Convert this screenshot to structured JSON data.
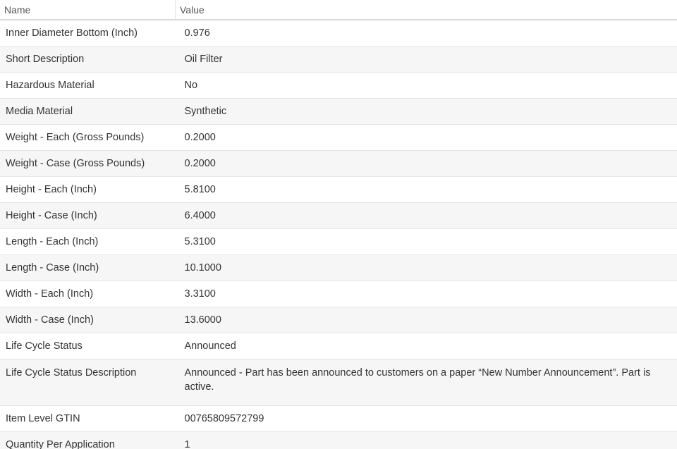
{
  "header": {
    "name_label": "Name",
    "value_label": "Value"
  },
  "rows": [
    {
      "name": "Inner Diameter Bottom (Inch)",
      "value": "0.976"
    },
    {
      "name": "Short Description",
      "value": "Oil Filter"
    },
    {
      "name": "Hazardous Material",
      "value": "No"
    },
    {
      "name": "Media Material",
      "value": "Synthetic"
    },
    {
      "name": "Weight - Each (Gross Pounds)",
      "value": "0.2000"
    },
    {
      "name": "Weight - Case (Gross Pounds)",
      "value": "0.2000"
    },
    {
      "name": "Height - Each (Inch)",
      "value": "5.8100"
    },
    {
      "name": "Height - Case (Inch)",
      "value": "6.4000"
    },
    {
      "name": "Length - Each (Inch)",
      "value": "5.3100"
    },
    {
      "name": "Length - Case (Inch)",
      "value": "10.1000"
    },
    {
      "name": "Width - Each (Inch)",
      "value": "3.3100"
    },
    {
      "name": "Width - Case (Inch)",
      "value": "13.6000"
    },
    {
      "name": "Life Cycle Status",
      "value": "Announced"
    },
    {
      "name": "Life Cycle Status Description",
      "value": "Announced - Part has been announced to customers on a paper “New Number Announcement”. Part is active."
    },
    {
      "name": "Item Level GTIN",
      "value": "00765809572799"
    },
    {
      "name": "Quantity Per Application",
      "value": "1"
    }
  ]
}
